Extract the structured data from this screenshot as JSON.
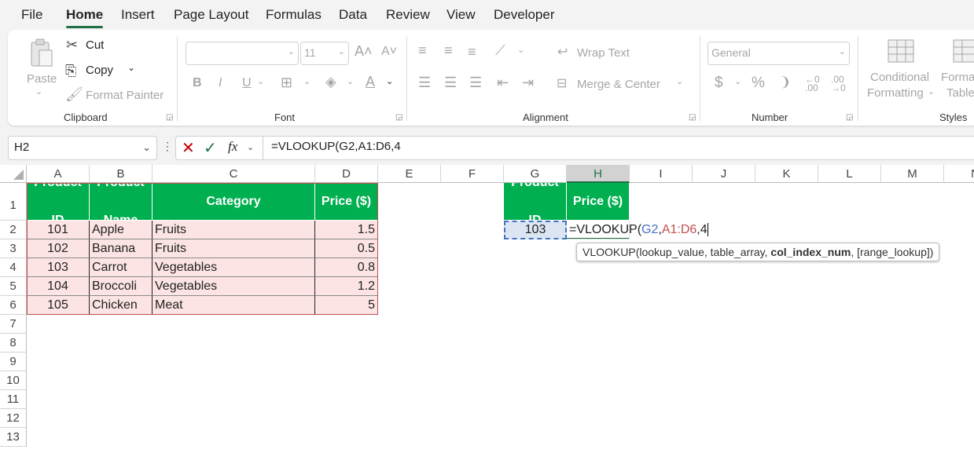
{
  "menu": {
    "tabs": [
      "File",
      "Home",
      "Insert",
      "Page Layout",
      "Formulas",
      "Data",
      "Review",
      "View",
      "Developer"
    ],
    "active": "Home"
  },
  "ribbon": {
    "clipboard": {
      "paste": "Paste",
      "cut": "Cut",
      "copy": "Copy",
      "format_painter": "Format Painter",
      "label": "Clipboard"
    },
    "font": {
      "font_name": "",
      "font_size": "11",
      "bold": "B",
      "italic": "I",
      "underline": "U",
      "label": "Font"
    },
    "alignment": {
      "wrap_text": "Wrap Text",
      "merge_center": "Merge & Center",
      "label": "Alignment"
    },
    "number": {
      "format": "General",
      "currency": "$",
      "percent": "%",
      "comma": "❩",
      "label": "Number"
    },
    "styles": {
      "conditional_formatting_1": "Conditional",
      "conditional_formatting_2": "Formatting",
      "format_table_1": "Forma",
      "format_table_2": "Table",
      "label": "Styles"
    }
  },
  "formula_bar": {
    "name_box": "H2",
    "formula": "=VLOOKUP(G2,A1:D6,4"
  },
  "columns": [
    "A",
    "B",
    "C",
    "D",
    "E",
    "F",
    "G",
    "H",
    "I",
    "J",
    "K",
    "L",
    "M",
    "N"
  ],
  "selected_column": "H",
  "rows": [
    "1",
    "2",
    "3",
    "4",
    "5",
    "6",
    "7",
    "8",
    "9",
    "10",
    "11",
    "12",
    "13"
  ],
  "table": {
    "headers": [
      [
        "Product",
        "ID"
      ],
      [
        "Product",
        "Name"
      ],
      [
        "Category"
      ],
      [
        "Price ($)"
      ]
    ],
    "rows": [
      [
        "101",
        "Apple",
        "Fruits",
        "1.5"
      ],
      [
        "102",
        "Banana",
        "Fruits",
        "0.5"
      ],
      [
        "103",
        "Carrot",
        "Vegetables",
        "0.8"
      ],
      [
        "104",
        "Broccoli",
        "Vegetables",
        "1.2"
      ],
      [
        "105",
        "Chicken",
        "Meat",
        "5"
      ]
    ]
  },
  "lookup": {
    "headers": [
      [
        "Product",
        "ID"
      ],
      [
        "Price ($)"
      ]
    ],
    "g2": "103",
    "h2_parts": {
      "fn": "=VLOOKUP(",
      "a1": "G2",
      ",1": ",",
      "a2": "A1:D6",
      ",2": ",",
      "a3": "4"
    }
  },
  "tooltip": {
    "prefix": "VLOOKUP(lookup_value, table_array, ",
    "bold": "col_index_num",
    ",suffix": ", [range_lookup])"
  },
  "colors": {
    "header_green": "#00b050",
    "row_pink": "#fce4e4",
    "accent": "#1e7145",
    "ref_blue": "#4472c4",
    "ref_red": "#c0504d"
  }
}
